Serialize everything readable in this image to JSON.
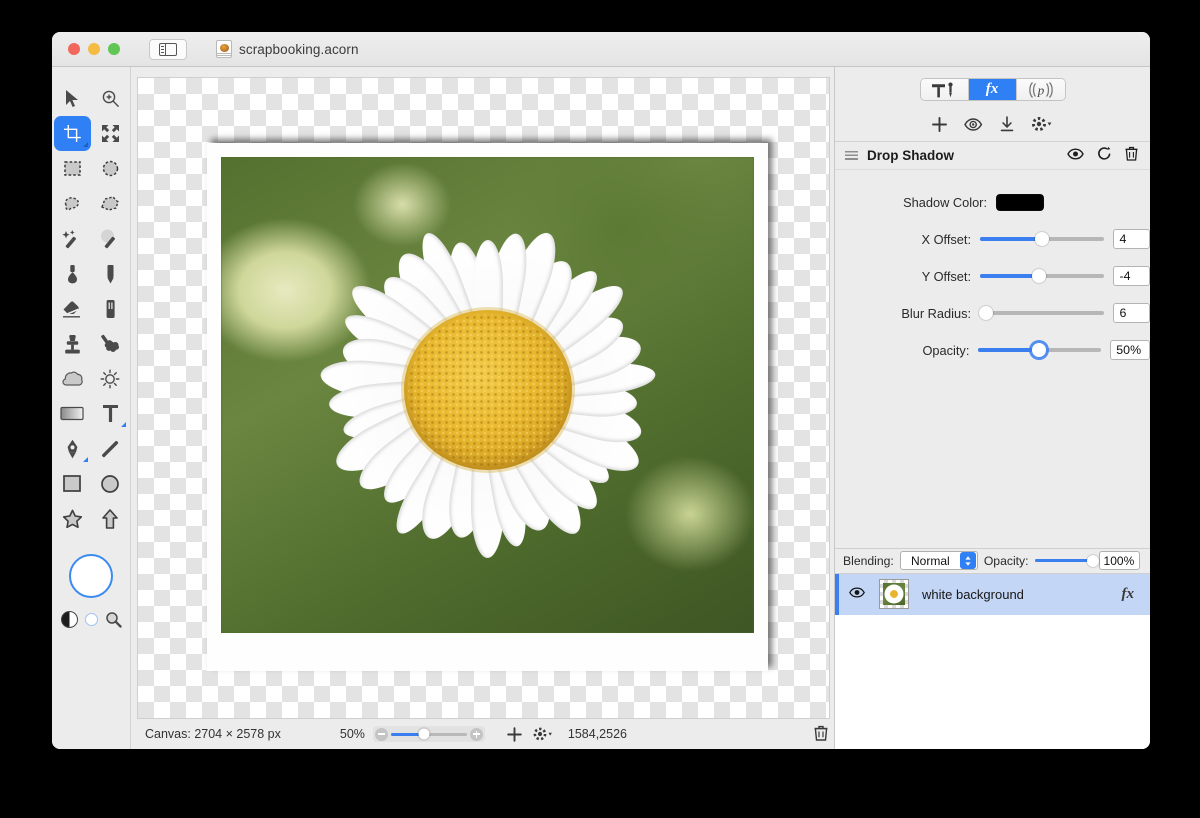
{
  "window": {
    "document_name": "scrapbooking.acorn",
    "traffic_lights": [
      "close",
      "minimize",
      "zoom"
    ]
  },
  "toolbar": {
    "sidebar_toggle": "sidebar-toggle"
  },
  "tools": {
    "selected": "crop",
    "items": [
      {
        "id": "move",
        "label": "Move",
        "icon": "arrow-cursor-icon"
      },
      {
        "id": "zoom",
        "label": "Zoom",
        "icon": "magnifier-plus-icon"
      },
      {
        "id": "crop",
        "label": "Crop",
        "icon": "crop-icon"
      },
      {
        "id": "transform",
        "label": "Transform",
        "icon": "arrows-expand-icon"
      },
      {
        "id": "rect-select",
        "label": "Rectangle Select",
        "icon": "marching-rectangle-icon"
      },
      {
        "id": "ellipse-select",
        "label": "Ellipse Select",
        "icon": "marching-ellipse-icon"
      },
      {
        "id": "lasso",
        "label": "Lasso",
        "icon": "lasso-icon"
      },
      {
        "id": "polygon-lasso",
        "label": "Polygon Lasso",
        "icon": "polygon-lasso-icon"
      },
      {
        "id": "magic-wand",
        "label": "Magic Wand",
        "icon": "magic-wand-icon"
      },
      {
        "id": "instant-alpha",
        "label": "Instant Alpha",
        "icon": "instant-alpha-icon"
      },
      {
        "id": "paint-bucket",
        "label": "Paint Bucket",
        "icon": "paint-bucket-icon"
      },
      {
        "id": "pencil",
        "label": "Pencil",
        "icon": "pencil-icon"
      },
      {
        "id": "eraser",
        "label": "Eraser",
        "icon": "eraser-icon"
      },
      {
        "id": "marker",
        "label": "Marker",
        "icon": "marker-icon"
      },
      {
        "id": "clone-stamp",
        "label": "Clone Stamp",
        "icon": "stamp-icon"
      },
      {
        "id": "smudge",
        "label": "Smudge",
        "icon": "smudge-icon"
      },
      {
        "id": "blur",
        "label": "Blur",
        "icon": "cloud-icon"
      },
      {
        "id": "dodge",
        "label": "Dodge",
        "icon": "sun-icon"
      },
      {
        "id": "gradient",
        "label": "Gradient",
        "icon": "gradient-icon"
      },
      {
        "id": "text",
        "label": "Text",
        "icon": "text-t-icon"
      },
      {
        "id": "bezier",
        "label": "Bezier Pen",
        "icon": "pen-nib-icon"
      },
      {
        "id": "line",
        "label": "Line",
        "icon": "line-icon"
      },
      {
        "id": "rectangle",
        "label": "Rectangle",
        "icon": "square-icon"
      },
      {
        "id": "ellipse",
        "label": "Ellipse",
        "icon": "circle-icon"
      },
      {
        "id": "star",
        "label": "Star",
        "icon": "star-icon"
      },
      {
        "id": "arrow",
        "label": "Arrow",
        "icon": "arrow-up-icon"
      }
    ],
    "fill_color": "#ffffff",
    "fill_ring_color": "#3a8af0",
    "bw_reset": "black-white-reset-icon",
    "swap_colors": "swap-colors-icon",
    "loupe": "magnifier-icon"
  },
  "canvas": {
    "image_alt": "white daisy flower on blurred green background with white photo border",
    "transparency_checker": true
  },
  "status_bar": {
    "canvas_size": "Canvas: 2704 × 2578 px",
    "zoom_level": "50%",
    "zoom_out_icon": "zoom-out-icon",
    "zoom_in_icon": "zoom-in-icon",
    "add_icon": "plus-icon",
    "gear_icon": "gear-dropdown-icon",
    "coordinates": "1584,2526",
    "trash_icon": "trash-icon"
  },
  "inspector": {
    "tabs": [
      {
        "id": "tools",
        "label": "",
        "icon": "hammer-tools-icon",
        "active": false
      },
      {
        "id": "filters",
        "label": "fx",
        "icon": "fx-icon",
        "active": true
      },
      {
        "id": "palette",
        "label": "p",
        "icon": "palette-p-icon",
        "active": false
      }
    ],
    "fx_toolbar": [
      {
        "id": "add-filter",
        "icon": "plus-icon"
      },
      {
        "id": "preview-filter",
        "icon": "eye-gear-icon"
      },
      {
        "id": "apply-filter",
        "icon": "download-arrow-icon"
      },
      {
        "id": "filter-actions",
        "icon": "gear-dropdown-icon"
      }
    ],
    "effect": {
      "title": "Drop Shadow",
      "grip_icon": "drag-handle-icon",
      "visibility_icon": "eye-icon",
      "reset_icon": "reset-arrow-icon",
      "delete_icon": "trash-icon",
      "shadow_color_label": "Shadow Color:",
      "shadow_color": "#000000",
      "controls": [
        {
          "id": "x-offset",
          "label": "X Offset:",
          "value": "4",
          "fill_pct": 50,
          "focused": false
        },
        {
          "id": "y-offset",
          "label": "Y Offset:",
          "value": "-4",
          "fill_pct": 47,
          "focused": false
        },
        {
          "id": "blur-radius",
          "label": "Blur Radius:",
          "value": "6",
          "fill_pct": 5,
          "focused": false
        },
        {
          "id": "opacity",
          "label": "Opacity:",
          "value": "50%",
          "fill_pct": 49,
          "focused": true
        }
      ]
    },
    "layers": {
      "blending_label": "Blending:",
      "blending_value": "Normal",
      "opacity_label": "Opacity:",
      "opacity_value": "100%",
      "opacity_fill_pct": 100,
      "rows": [
        {
          "name": "white background",
          "visible": true,
          "selected": true,
          "has_effects": true,
          "fx_badge": "fx",
          "eye_icon": "eye-icon",
          "thumbnail": "layer-thumbnail-daisy"
        }
      ]
    }
  },
  "colors": {
    "accent_blue": "#2f7ff5",
    "selection_blue": "#c3d6f5",
    "window_chrome": "#ececec",
    "shadow_swatch": "#000000"
  }
}
